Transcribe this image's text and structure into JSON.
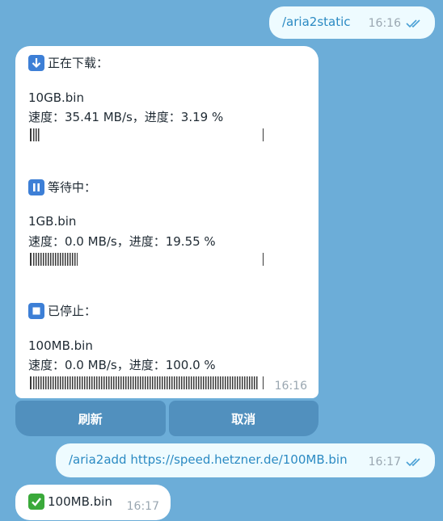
{
  "messages": {
    "cmd1": {
      "text": "/aria2static",
      "time": "16:16"
    },
    "status": {
      "downloading": {
        "header": "正在下载：",
        "file": "10GB.bin",
        "line": "速度：35.41 MB/s，进度：3.19 %",
        "progress": 0.0319
      },
      "waiting": {
        "header": "等待中：",
        "file": "1GB.bin",
        "line": "速度：0.0 MB/s，进度：19.55 %",
        "progress": 0.1955
      },
      "stopped": {
        "header": "已停止：",
        "file": "100MB.bin",
        "line": "速度：0.0 MB/s，进度：100.0 %",
        "progress": 1.0
      },
      "time": "16:16"
    },
    "buttons": {
      "refresh": "刷新",
      "cancel": "取消"
    },
    "cmd2": {
      "text": "/aria2add https://speed.hetzner.de/100MB.bin",
      "time": "16:17"
    },
    "reply": {
      "text": "100MB.bin",
      "time": "16:17"
    }
  },
  "icons": {
    "download": "down-arrow-emoji",
    "pause": "pause-emoji",
    "stop": "stop-emoji",
    "check": "check-mark-emoji",
    "read_ticks": "double-check-icon"
  },
  "colors": {
    "background": "#6cadd8",
    "outgoing": "#eefbff",
    "link": "#2b8ac3",
    "emoji_blue": "#3d7fd6",
    "emoji_green": "#3aa93a"
  }
}
